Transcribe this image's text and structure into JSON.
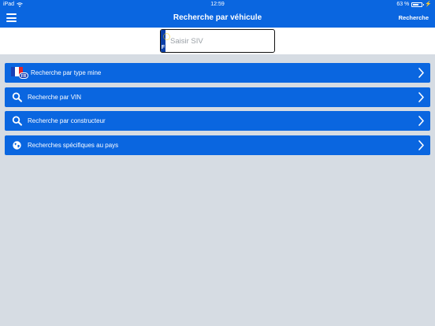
{
  "status_bar": {
    "device": "iPad",
    "time": "12:59",
    "battery": "63 %"
  },
  "nav": {
    "title": "Recherche par véhicule",
    "action": "Recherche"
  },
  "plate": {
    "country_letter": "F",
    "placeholder": "Saisir SIV"
  },
  "menu": {
    "items": [
      {
        "label": "Recherche par type mine",
        "icon": "france-flag-icon"
      },
      {
        "label": "Recherche par VIN",
        "icon": "search-icon"
      },
      {
        "label": "Recherche par constructeur",
        "icon": "search-icon"
      },
      {
        "label": "Recherches spécifiques au pays",
        "icon": "globe-icon"
      }
    ],
    "flag_badge": "FR"
  },
  "colors": {
    "primary": "#0a66e0",
    "background": "#d6dce3",
    "eu_blue": "#0a3fa8"
  }
}
